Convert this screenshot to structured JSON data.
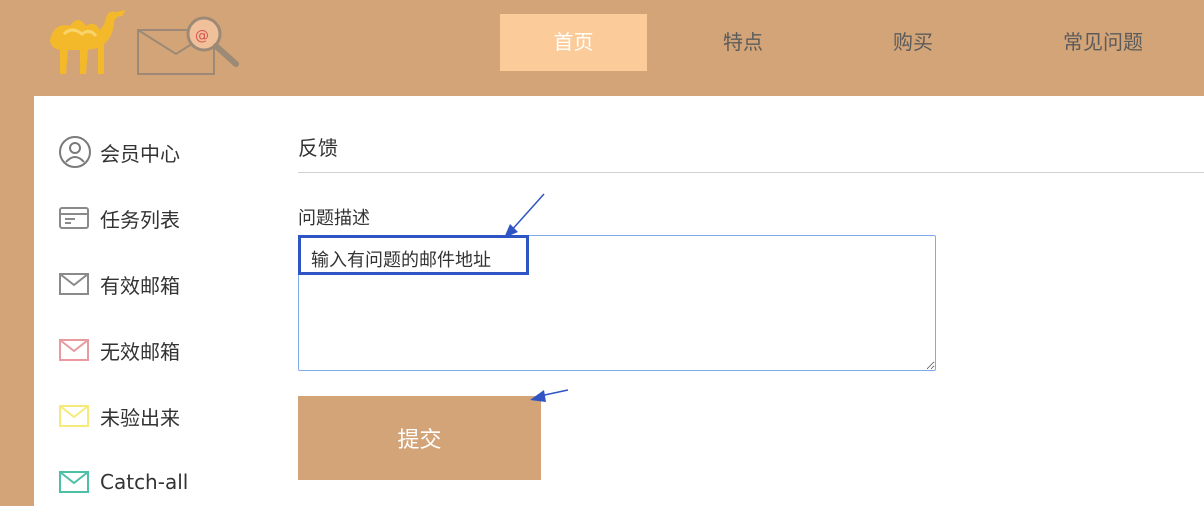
{
  "nav": {
    "items": [
      {
        "label": "首页",
        "active": true
      },
      {
        "label": "特点",
        "active": false
      },
      {
        "label": "购买",
        "active": false
      },
      {
        "label": "常见问题",
        "active": false
      }
    ]
  },
  "sidebar": {
    "items": [
      {
        "label": "会员中心",
        "icon": "user-icon"
      },
      {
        "label": "任务列表",
        "icon": "task-list-icon"
      },
      {
        "label": "有效邮箱",
        "icon": "mail-icon",
        "color": "#8a8a8a"
      },
      {
        "label": "无效邮箱",
        "icon": "mail-icon",
        "color": "#e89aa0"
      },
      {
        "label": "未验出来",
        "icon": "mail-icon",
        "color": "#f6ea7a"
      },
      {
        "label": "Catch-all",
        "icon": "mail-icon",
        "color": "#4dbfa6"
      }
    ]
  },
  "main": {
    "title": "反馈",
    "field_label": "问题描述",
    "textarea_value": "输入有问题的邮件地址",
    "submit_label": "提交"
  },
  "colors": {
    "header_bg": "#d3a478",
    "nav_active_bg": "#fbcb99",
    "button_bg": "#d3a478",
    "annotation_blue": "#2f55c4"
  }
}
